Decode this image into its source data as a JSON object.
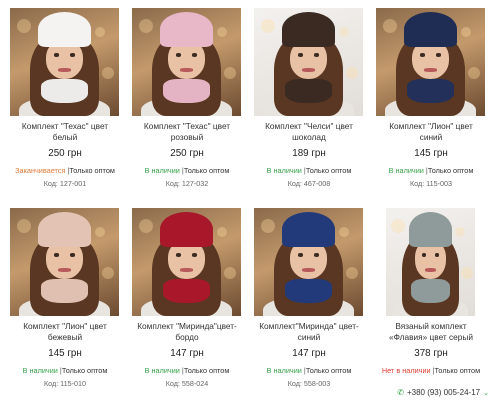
{
  "products": [
    {
      "title_line1": "Комплект \"Техас\" цвет",
      "title_line2": "белый",
      "price": "250 грн",
      "stock": "Заканчивается",
      "stock_color": "#e27a36",
      "wholesale": "Только оптом",
      "code": "Код: 127-001",
      "hat_color": "#f4f3f1",
      "scarf_color": "#ecebea",
      "photo": "dark"
    },
    {
      "title_line1": "Комплект \"Техас\" цвет",
      "title_line2": "розовый",
      "price": "250 грн",
      "stock": "В наличии",
      "stock_color": "#36a14a",
      "wholesale": "Только оптом",
      "code": "Код: 127-032",
      "hat_color": "#e8b7c8",
      "scarf_color": "#e5b4c4",
      "photo": "dark"
    },
    {
      "title_line1": "Комплект \"Челси\" цвет",
      "title_line2": "шоколад",
      "price": "189 грн",
      "stock": "В наличии",
      "stock_color": "#36a14a",
      "wholesale": "Только оптом",
      "code": "Код: 467-008",
      "hat_color": "#3a2a22",
      "scarf_color": "#3a2a22",
      "photo": "light"
    },
    {
      "title_line1": "Комплект \"Лион\" цвет",
      "title_line2": "синий",
      "price": "145 грн",
      "stock": "В наличии",
      "stock_color": "#36a14a",
      "wholesale": "Только оптом",
      "code": "Код: 115-003",
      "hat_color": "#1f2d55",
      "scarf_color": "#22305a",
      "photo": "dark"
    },
    {
      "title_line1": "Комплект \"Лион\" цвет",
      "title_line2": "бежевый",
      "price": "145 грн",
      "stock": "В наличии",
      "stock_color": "#36a14a",
      "wholesale": "Только оптом",
      "code": "Код: 115-010",
      "hat_color": "#e3c4b4",
      "scarf_color": "#e0c1b1",
      "photo": "dark"
    },
    {
      "title_line1": "Комплект \"Миринда\"цвет-",
      "title_line2": "бордо",
      "price": "147 грн",
      "stock": "В наличии",
      "stock_color": "#36a14a",
      "wholesale": "Только оптом",
      "code": "Код: 558-024",
      "hat_color": "#a8182a",
      "scarf_color": "#a8182a",
      "photo": "dark"
    },
    {
      "title_line1": "Комплект\"Миринда\" цвет-",
      "title_line2": "синий",
      "price": "147 грн",
      "stock": "В наличии",
      "stock_color": "#36a14a",
      "wholesale": "Только оптом",
      "code": "Код: 558-003",
      "hat_color": "#233a7a",
      "scarf_color": "#233a7a",
      "photo": "dark"
    },
    {
      "title_line1": "Вязаный комплект",
      "title_line2": "«Флавия» цвет серый",
      "price": "378 грн",
      "stock": "Нет в наличии",
      "stock_color": "#e13b33",
      "wholesale": "Только оптом",
      "code": "",
      "hat_color": "#8f9b9a",
      "scarf_color": "#8f9b9a",
      "photo": "light-narrow"
    }
  ],
  "footer": {
    "phone": "+380 (93) 005-24-17",
    "phone_icon": "phone-icon",
    "chevron_icon": "chevron-down-icon"
  }
}
